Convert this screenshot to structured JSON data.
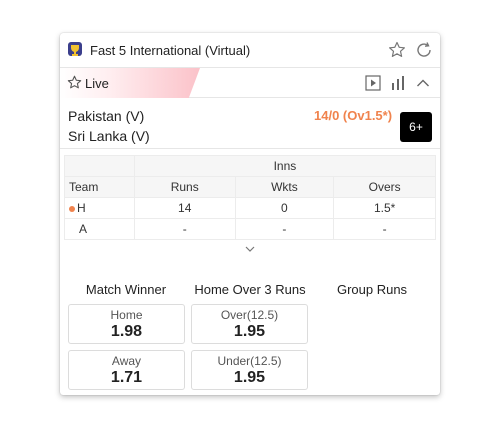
{
  "header": {
    "title": "Fast 5 International (Virtual)",
    "icons": [
      "trophy-icon",
      "star-outline-icon",
      "refresh-icon"
    ]
  },
  "livebar": {
    "label": "Live",
    "icons": [
      "star-outline-icon",
      "play-icon",
      "bar-chart-icon",
      "chevron-up-icon"
    ]
  },
  "match": {
    "team1": "Pakistan (V)",
    "team2": "Sri Lanka (V)",
    "score": "14/0 (Ov1.5*)",
    "age_badge": "6+"
  },
  "scoreboard": {
    "group_header": "Inns",
    "columns": [
      "Team",
      "Runs",
      "Wkts",
      "Overs"
    ],
    "rows": [
      {
        "team": "H",
        "runs": "14",
        "wkts": "0",
        "overs": "1.5*"
      },
      {
        "team": "A",
        "runs": "-",
        "wkts": "-",
        "overs": "-"
      }
    ]
  },
  "markets": [
    {
      "title": "Match Winner",
      "selections": [
        {
          "label": "Home",
          "odds": "1.98"
        },
        {
          "label": "Away",
          "odds": "1.71"
        }
      ]
    },
    {
      "title": "Home Over 3 Runs",
      "selections": [
        {
          "label": "Over(12.5)",
          "odds": "1.95"
        },
        {
          "label": "Under(12.5)",
          "odds": "1.95"
        }
      ]
    },
    {
      "title": "Group Runs",
      "selections": []
    }
  ],
  "colors": {
    "accent_orange": "#f0834d",
    "live_gradient_end": "#fbc2c9",
    "badge_bg": "#000000"
  }
}
